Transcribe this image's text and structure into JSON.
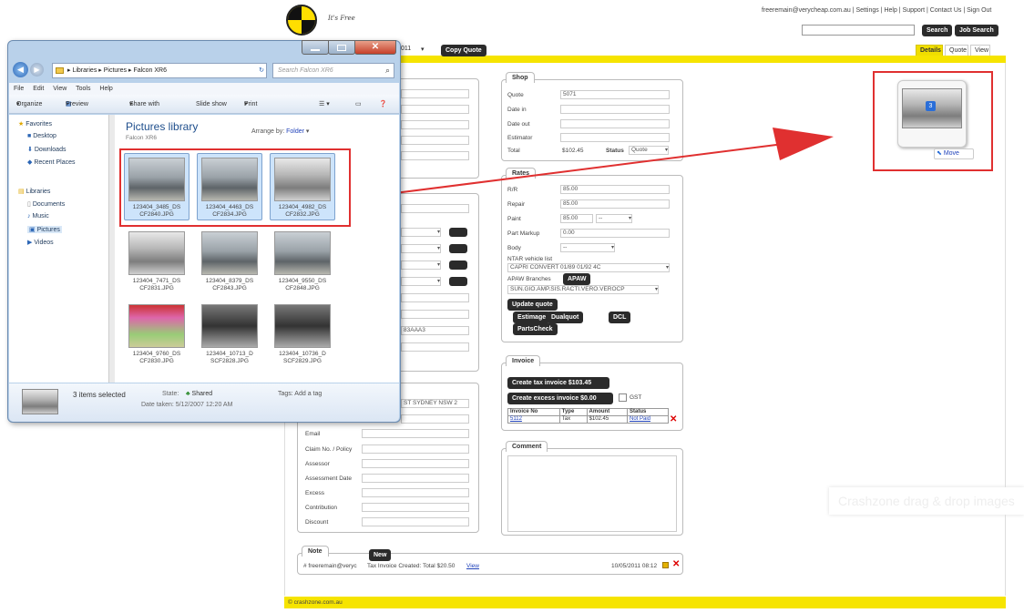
{
  "webapp": {
    "logo_text": "It's Free",
    "top_links": "freeremain@verycheap.com.au | Settings | Help | Support | Contact Us | Sign Out",
    "search_label": "Search",
    "job_search_label": "Job Search",
    "copy_quote_label": "Copy Quote",
    "quote_id_partial": "011",
    "tabs": [
      "Details",
      "Quote",
      "View"
    ],
    "shop": {
      "title": "Shop",
      "labels": [
        "Quote",
        "Date in",
        "Date out",
        "Estimator",
        "Total"
      ],
      "quote_value": "5071",
      "total_value": "$102.45",
      "status_label": "Status",
      "status_value": "Quote"
    },
    "rates": {
      "title": "Rates",
      "labels": [
        "R/R",
        "Repair",
        "Paint",
        "Part Markup",
        "Body"
      ],
      "rr": "85.00",
      "repair": "85.00",
      "paint": "85.00",
      "part_markup": "0.00",
      "body": "--",
      "ntar_label": "NTAR vehicle list",
      "ntar_value": "CAPRI CONVERT 01/89 01/92 4C",
      "apaw_label": "APAW Branches",
      "apaw_btn": "APAW",
      "branch_value": "SUN.GIO.AMP.SIS.RACTI.VERO.VEROCP",
      "update_btn": "Update quote",
      "btn_estimage": "Estimage",
      "btn_dualquot": "Dualquot",
      "btn_dcl": "DCL",
      "btn_partscheck": "PartsCheck"
    },
    "invoice": {
      "title": "Invoice",
      "create_tax": "Create tax invoice $103.45",
      "create_excess": "Create excess invoice $0.00",
      "gst_label": "GST",
      "headers": [
        "Invoice No",
        "Type",
        "Amount",
        "Status"
      ],
      "row": [
        "5112",
        "Tax",
        "$102.45",
        "Not Paid"
      ]
    },
    "comment_title": "Comment",
    "left_form": {
      "labels": [
        "Email",
        "Claim No. / Policy",
        "Assessor",
        "Assessment Date",
        "Excess",
        "Contribution",
        "Discount"
      ],
      "address_fragment": "ST SYDNEY NSW 2",
      "vin_fragment": "83AAA3"
    },
    "note": {
      "title": "Note",
      "new_btn": "New",
      "author": "# freeremain@veryc",
      "text": "Tax Invoice Created: Total $20.50",
      "view_link": "View",
      "timestamp": "10/05/2011 08:12"
    },
    "footer": "© crashzone.com.au",
    "drag_hint": "Crashzone drag & drop images",
    "upload_move_label": "Move",
    "upload_count": "3"
  },
  "explorer": {
    "address": [
      "Libraries",
      "Pictures",
      "Falcon XR6"
    ],
    "search_placeholder": "Search Falcon XR6",
    "menu": [
      "File",
      "Edit",
      "View",
      "Tools",
      "Help"
    ],
    "toolbar": [
      "Organize",
      "Preview",
      "Share with",
      "Slide show",
      "Print"
    ],
    "nav": {
      "favorites": "Favorites",
      "desktop": "Desktop",
      "downloads": "Downloads",
      "recent": "Recent Places",
      "libraries": "Libraries",
      "documents": "Documents",
      "music": "Music",
      "pictures": "Pictures",
      "videos": "Videos"
    },
    "library_title": "Pictures library",
    "library_sub": "Falcon XR6",
    "arrange_label": "Arrange by:",
    "arrange_value": "Folder",
    "files": [
      "123404_3485_DS CF2840.JPG",
      "123404_4463_DS CF2834.JPG",
      "123404_4982_DS CF2832.JPG",
      "123404_7471_DS CF2831.JPG",
      "123404_8379_DS CF2843.JPG",
      "123404_9550_DS CF2848.JPG",
      "123404_9760_DS CF2830.JPG",
      "123404_10713_D SCF2828.JPG",
      "123404_10736_D SCF2829.JPG"
    ],
    "status": {
      "selected": "3 items selected",
      "state_label": "State:",
      "state_value": "Shared",
      "tags": "Tags: Add a tag",
      "date": "Date taken: 5/12/2007 12:20 AM"
    }
  },
  "colors": {
    "accent_yellow": "#f6e400",
    "highlight_red": "#e03030",
    "dark_button": "#2b2b2b"
  }
}
